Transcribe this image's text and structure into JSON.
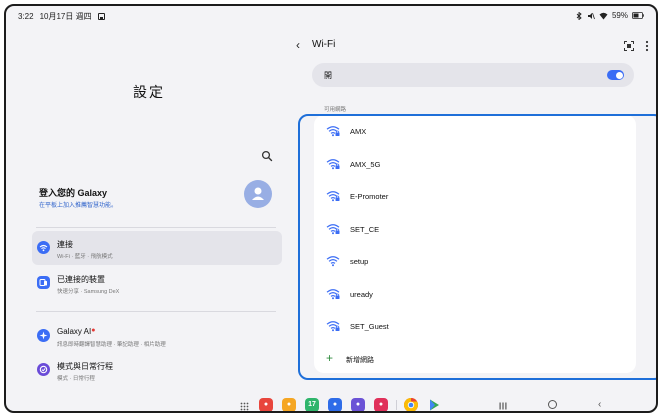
{
  "status_bar": {
    "time": "3:22",
    "date": "10月17日 週四",
    "battery": "59%"
  },
  "settings_panel": {
    "title": "設定",
    "account": {
      "name": "登入您的 Galaxy",
      "subtitle": "在平板上加入推薦智慧功能。"
    },
    "menu": [
      {
        "title": "連接",
        "subtitle": "Wi-Fi · 藍牙 · 飛航模式",
        "icon": "wifi-icon",
        "color": "#3b6df5",
        "selected": true
      },
      {
        "title": "已連接的裝置",
        "subtitle": "快速分享 · Samsung DeX",
        "icon": "devices-icon",
        "color": "#3b6df5",
        "selected": false
      },
      {
        "title": "Galaxy AI",
        "subtitle": "訊息即時翻譯智慧助理 · 筆記助理 · 相片助理",
        "icon": "ai-star-icon",
        "color": "#3b6df5",
        "selected": false
      },
      {
        "title": "模式與日常行程",
        "subtitle": "模式 · 日常行程",
        "icon": "modes-icon",
        "color": "#6a4bd8",
        "selected": false
      }
    ]
  },
  "wifi_panel": {
    "title": "Wi-Fi",
    "toggle_label": "開",
    "toggle_on": true,
    "section_label": "可用網路",
    "networks": [
      {
        "name": "AMX",
        "secured": true
      },
      {
        "name": "AMX_5G",
        "secured": true
      },
      {
        "name": "E-Promoter",
        "secured": true
      },
      {
        "name": "SET_CE",
        "secured": true
      },
      {
        "name": "setup",
        "secured": false
      },
      {
        "name": "uready",
        "secured": true
      },
      {
        "name": "SET_Guest",
        "secured": true
      }
    ],
    "add_network_label": "新增網路"
  },
  "colors": {
    "accent": "#3b6df5",
    "highlight": "#1e6fd9",
    "add": "#2e8b3c"
  },
  "taskbar": {
    "apps": [
      {
        "name": "samsung-notes-icon",
        "color": "#e8453c"
      },
      {
        "name": "my-files-icon",
        "color": "#f5a623"
      },
      {
        "name": "calendar-icon",
        "color": "#2fb56b"
      },
      {
        "name": "messages-icon",
        "color": "#2e6ce8"
      },
      {
        "name": "internet-icon",
        "color": "#6b52d6"
      },
      {
        "name": "screen-recorder-icon",
        "color": "#e0305a"
      },
      {
        "name": "chrome-icon",
        "color": "#dd4b39"
      },
      {
        "name": "play-store-icon",
        "color": "#34a853"
      }
    ],
    "calendar_day": "17"
  }
}
